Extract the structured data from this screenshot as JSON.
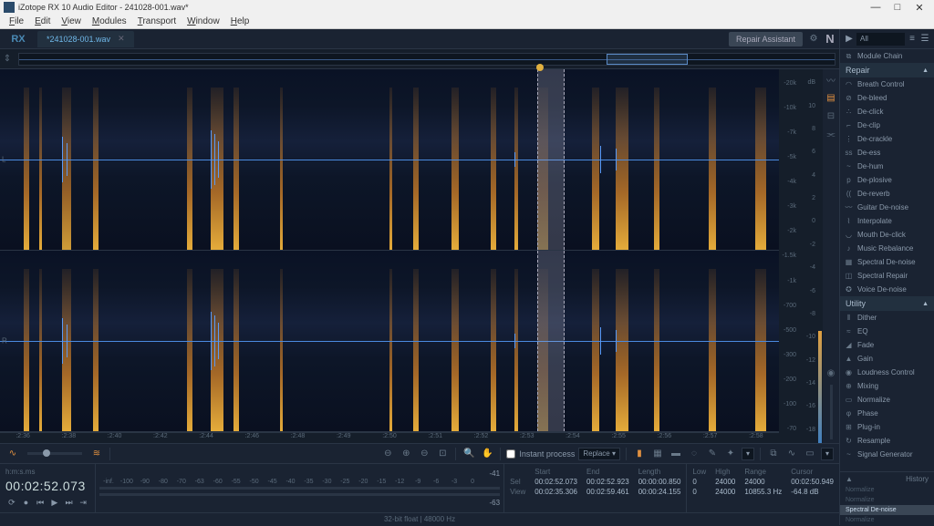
{
  "window": {
    "title": "iZotope RX 10 Audio Editor - 241028-001.wav*",
    "min": "—",
    "max": "□",
    "close": "✕"
  },
  "menu": [
    {
      "u": "F",
      "r": "ile"
    },
    {
      "u": "E",
      "r": "dit"
    },
    {
      "u": "V",
      "r": "iew"
    },
    {
      "u": "M",
      "r": "odules"
    },
    {
      "u": "T",
      "r": "ransport"
    },
    {
      "u": "W",
      "r": "indow"
    },
    {
      "u": "H",
      "r": "elp"
    }
  ],
  "logo": "RX",
  "tab": {
    "name": "*241028-001.wav"
  },
  "repair_assistant": "Repair Assistant",
  "n_logo": "N",
  "time_ruler": [
    ":2:36",
    ":2:38",
    ":2:40",
    ":2:42",
    ":2:44",
    ":2:46",
    ":2:48",
    ":2:49",
    ":2:50",
    ":2:51",
    ":2:52",
    ":2:53",
    ":2:54",
    ":2:55",
    ":2:56",
    ":2:57",
    ":2:58"
  ],
  "freq_scale": [
    "-20k",
    "-10k",
    "-7k",
    "-5k",
    "-4k",
    "-3k",
    "-2k",
    "-1.5k",
    "-1k",
    "-700",
    "-500",
    "-300",
    "-200",
    "-100",
    "-70"
  ],
  "db_scale": [
    "dB",
    "10",
    "8",
    "6",
    "4",
    "2",
    "0",
    "-2",
    "-4",
    "-6",
    "-8",
    "-10",
    "-12",
    "-14",
    "-16",
    "-18"
  ],
  "channel_l": "L",
  "channel_r": "R",
  "instant": {
    "checkbox_label": "Instant process",
    "mode": "Replace",
    "dd": "▾"
  },
  "db_ruler": {
    "marks": [
      "-inf.",
      "-100",
      "-90",
      "-80",
      "-70",
      "-63",
      "-60",
      "-55",
      "-50",
      "-45",
      "-40",
      "-35",
      "-30",
      "-25",
      "-20",
      "-15",
      "-12",
      "-9",
      "-6",
      "-3",
      "0"
    ],
    "val_l": "-41",
    "val_r": "-63"
  },
  "time": {
    "unit": "h:m:s.ms",
    "value": "00:02:52.073"
  },
  "info": {
    "cols": [
      "",
      "Start",
      "End",
      "Length"
    ],
    "sel": [
      "Sel",
      "00:02:52.073",
      "00:02:52.923",
      "00:00:00.850"
    ],
    "view": [
      "View",
      "00:02:35.306",
      "00:02:59.461",
      "00:00:24.155"
    ],
    "freq_cols": [
      "Low",
      "High",
      "Range",
      "Cursor"
    ],
    "freq_sel": [
      "0",
      "24000",
      "24000",
      "00:02:50.949"
    ],
    "freq_view": [
      "0",
      "24000",
      "10855.3 Hz",
      "-64.8 dB"
    ]
  },
  "status": "32-bit float | 48000 Hz",
  "panel": {
    "all": "All",
    "module_chain": "Module Chain"
  },
  "repair_h": "Repair",
  "repair_mods": [
    "Breath Control",
    "De-bleed",
    "De-click",
    "De-clip",
    "De-crackle",
    "De-ess",
    "De-hum",
    "De-plosive",
    "De-reverb",
    "Guitar De-noise",
    "Interpolate",
    "Mouth De-click",
    "Music Rebalance",
    "Spectral De-noise",
    "Spectral Repair",
    "Voice De-noise"
  ],
  "utility_h": "Utility",
  "utility_mods": [
    "Dither",
    "EQ",
    "Fade",
    "Gain",
    "Loudness Control",
    "Mixing",
    "Normalize",
    "Phase",
    "Plug-in",
    "Resample",
    "Signal Generator"
  ],
  "history_h": "History",
  "history": [
    "Normalize",
    "Normalize",
    "Spectral De-noise",
    "Normalize"
  ],
  "hist_arrow": "▲"
}
